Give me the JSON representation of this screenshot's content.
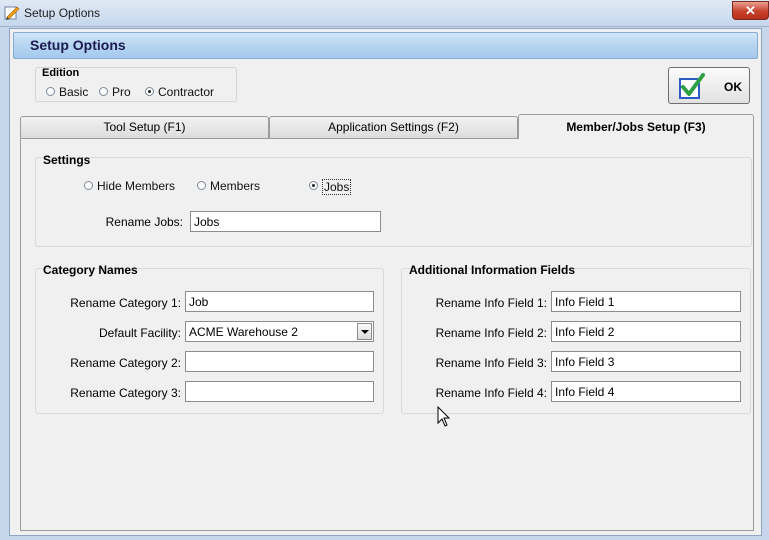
{
  "window": {
    "title": "Setup Options",
    "close_glyph": "✕"
  },
  "header": {
    "title": "Setup Options"
  },
  "edition": {
    "label": "Edition",
    "options": [
      {
        "label": "Basic",
        "selected": false
      },
      {
        "label": "Pro",
        "selected": false
      },
      {
        "label": "Contractor",
        "selected": true
      }
    ]
  },
  "ok_button": {
    "label": "OK",
    "icon": "checkbox-check-icon"
  },
  "tabs": [
    {
      "label": "Tool Setup (F1)",
      "active": false
    },
    {
      "label": "Application Settings (F2)",
      "active": false
    },
    {
      "label": "Member/Jobs Setup (F3)",
      "active": true
    }
  ],
  "settings": {
    "label": "Settings",
    "mode_options": [
      {
        "label": "Hide Members",
        "selected": false
      },
      {
        "label": "Members",
        "selected": false
      },
      {
        "label": "Jobs",
        "selected": true
      }
    ],
    "rename_jobs_label": "Rename Jobs:",
    "rename_jobs_value": "Jobs"
  },
  "category_names": {
    "label": "Category Names",
    "fields": [
      {
        "label": "Rename Category 1:",
        "value": "Job",
        "type": "text"
      },
      {
        "label": "Default Facility:",
        "value": "ACME Warehouse 2",
        "type": "select"
      },
      {
        "label": "Rename Category 2:",
        "value": "",
        "type": "text"
      },
      {
        "label": "Rename Category 3:",
        "value": "",
        "type": "text"
      }
    ]
  },
  "info_fields": {
    "label": "Additional Information Fields",
    "fields": [
      {
        "label": "Rename Info Field 1:",
        "value": "Info Field 1"
      },
      {
        "label": "Rename Info Field 2:",
        "value": "Info Field 2"
      },
      {
        "label": "Rename Info Field 3:",
        "value": "Info Field 3"
      },
      {
        "label": "Rename Info Field 4:",
        "value": "Info Field 4"
      }
    ]
  },
  "colors": {
    "header_text": "#1a1a50",
    "close_button": "#c7402a",
    "check_green": "#2ea043",
    "check_box_border": "#2a5cc4"
  }
}
